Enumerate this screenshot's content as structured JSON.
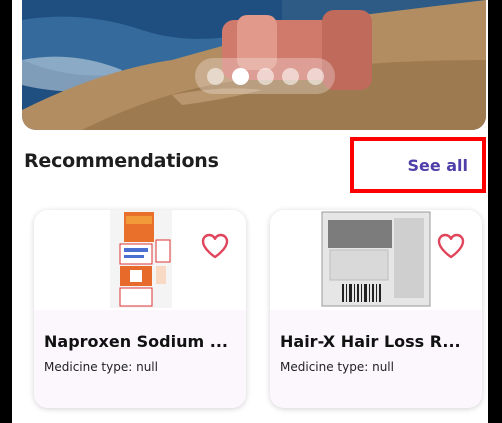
{
  "banner": {
    "carousel": {
      "total": 5,
      "active": 1
    }
  },
  "recommendations": {
    "title": "Recommendations",
    "see_all_label": "See all",
    "products": [
      {
        "name": "Naproxen Sodium ...",
        "type": "Medicine type: null",
        "favorite_icon": "heart-outline-icon"
      },
      {
        "name": "Hair-X Hair Loss R...",
        "type": "Medicine type: null",
        "favorite_icon": "heart-outline-icon"
      }
    ]
  },
  "colors": {
    "accent": "#4f3fa8",
    "heart": "#e0455b",
    "highlight": "#ff0000"
  }
}
